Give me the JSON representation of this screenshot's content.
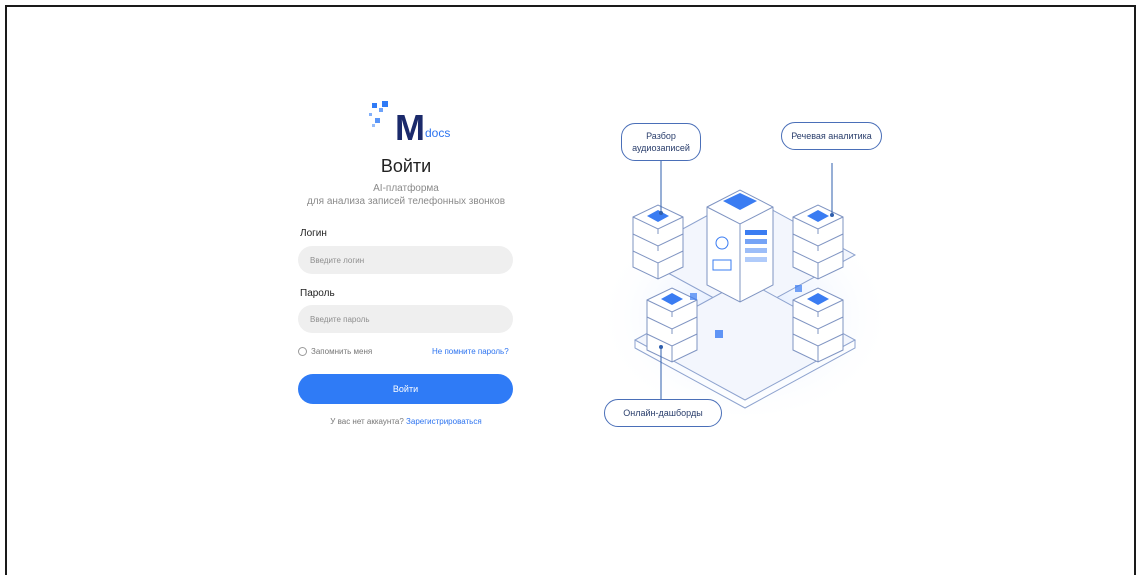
{
  "brand": {
    "logo_letter": "M",
    "logo_suffix": "docs"
  },
  "login": {
    "title": "Войти",
    "subtitle_line1": "AI-платформа",
    "subtitle_line2": "для анализа записей телефонных звонков",
    "login_label": "Логин",
    "login_placeholder": "Введите логин",
    "password_label": "Пароль",
    "password_placeholder": "Введите пароль",
    "remember_label": "Запомнить меня",
    "forgot_link": "Не помните пароль?",
    "submit_label": "Войти",
    "no_account_text": "У вас нет аккаунта?",
    "register_link": "Зарегистрироваться"
  },
  "illustration": {
    "bubble_audio": "Разбор аудиозаписей",
    "bubble_speech": "Речевая аналитика",
    "bubble_dash": "Онлайн-дашборды"
  },
  "colors": {
    "accent": "#2f7bf6",
    "brand_dark": "#1b2a6b",
    "link": "#2d74f0"
  }
}
